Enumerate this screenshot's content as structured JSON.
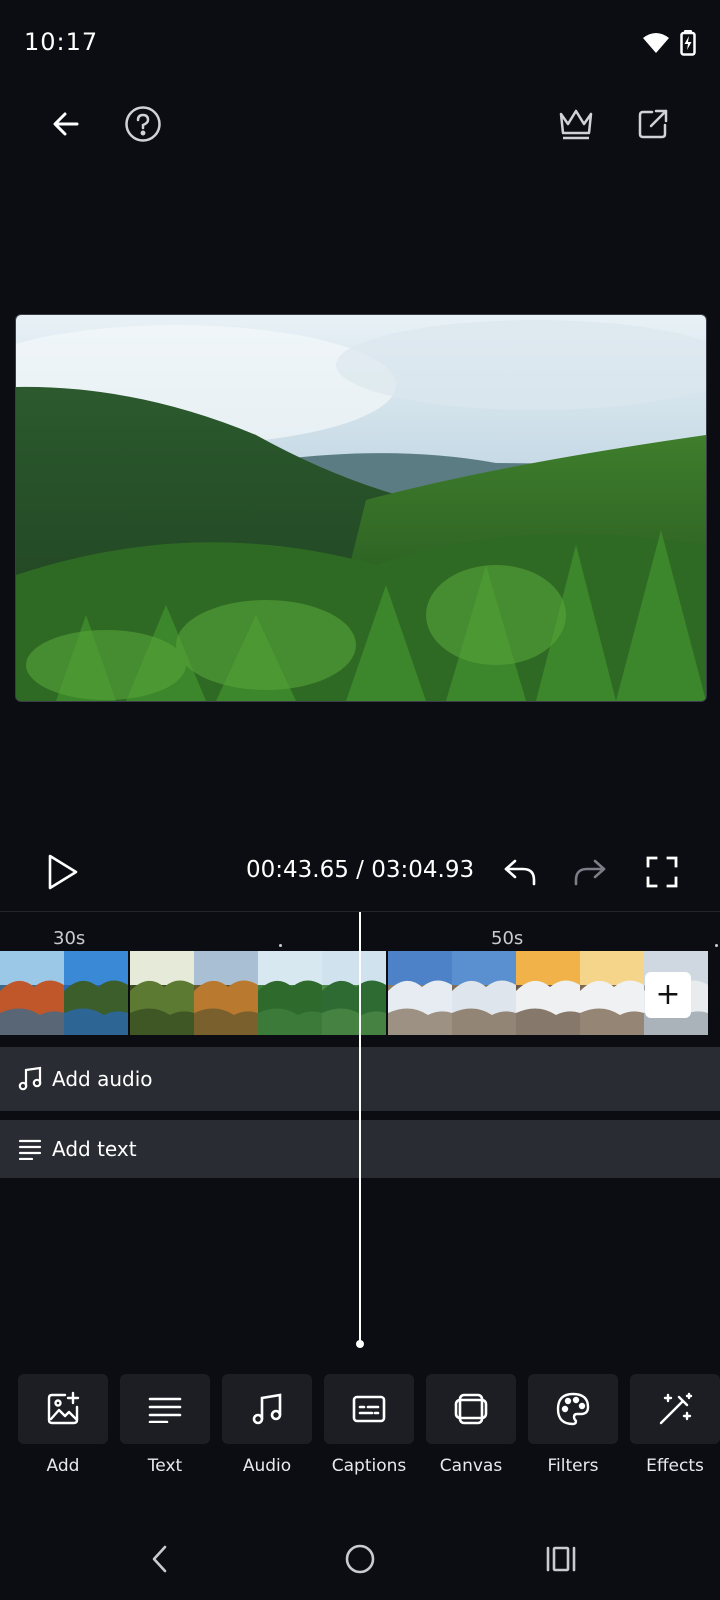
{
  "status": {
    "time": "10:17",
    "icons": [
      "wifi-icon",
      "battery-charging-icon"
    ]
  },
  "header": {
    "back_icon": "arrow-left-icon",
    "help_icon": "question-circle-icon",
    "premium_icon": "crown-icon",
    "export_icon": "share-external-icon"
  },
  "player": {
    "current_time": "00:43.65",
    "separator": " / ",
    "total_time": "03:04.93",
    "play_icon": "play-icon",
    "undo_icon": "undo-icon",
    "redo_icon": "redo-icon",
    "fullscreen_icon": "fullscreen-icon"
  },
  "timeline": {
    "ruler": [
      "30s",
      "50s"
    ],
    "thumbnails": [
      {
        "sky": "#9cc8e8",
        "land": "#c0572a",
        "water": "#3d6a8a"
      },
      {
        "sky": "#3a89d6",
        "land": "#3b5e2a",
        "water": "#2a66b0"
      },
      {
        "sky": "#e6ead8",
        "land": "#5d7a33",
        "water": "#384d22"
      },
      {
        "sky": "#a9c0d4",
        "land": "#b9792f",
        "water": "#6a5a2c"
      },
      {
        "sky": "#d8e8f0",
        "land": "#2f6a2d",
        "water": "#3e7e3b"
      },
      {
        "sky": "#cfe2ee",
        "land": "#2d6b33",
        "water": "#4c8a46"
      },
      {
        "sky": "#4d82c8",
        "land": "#e7ecf2",
        "water": "#8a7a66"
      },
      {
        "sky": "#5a8fd0",
        "land": "#dfe5ec",
        "water": "#7e6d58"
      },
      {
        "sky": "#f2b24a",
        "land": "#eef0f2",
        "water": "#6c5a48"
      },
      {
        "sky": "#f5d58a",
        "land": "#f0f1f3",
        "water": "#7d6a55"
      },
      {
        "sky": "#cfd8e0",
        "land": "#e9ecef",
        "water": "#9aa4ac"
      }
    ],
    "add_clip_label": "+",
    "tracks": {
      "audio": {
        "label": "Add audio",
        "icon": "music-note-icon"
      },
      "text": {
        "label": "Add text",
        "icon": "text-lines-icon"
      }
    }
  },
  "tools": [
    {
      "label": "Add",
      "icon": "add-image-icon"
    },
    {
      "label": "Text",
      "icon": "text-lines-icon"
    },
    {
      "label": "Audio",
      "icon": "music-note-icon"
    },
    {
      "label": "Captions",
      "icon": "captions-icon"
    },
    {
      "label": "Canvas",
      "icon": "canvas-icon"
    },
    {
      "label": "Filters",
      "icon": "palette-icon"
    },
    {
      "label": "Effects",
      "icon": "magic-wand-icon"
    }
  ],
  "navbar": {
    "back_icon": "nav-back-icon",
    "home_icon": "nav-home-icon",
    "recents_icon": "nav-recents-icon"
  },
  "colors": {
    "background": "#0c0d12",
    "track": "#2a2c33",
    "tool_box": "#1c1e24"
  }
}
